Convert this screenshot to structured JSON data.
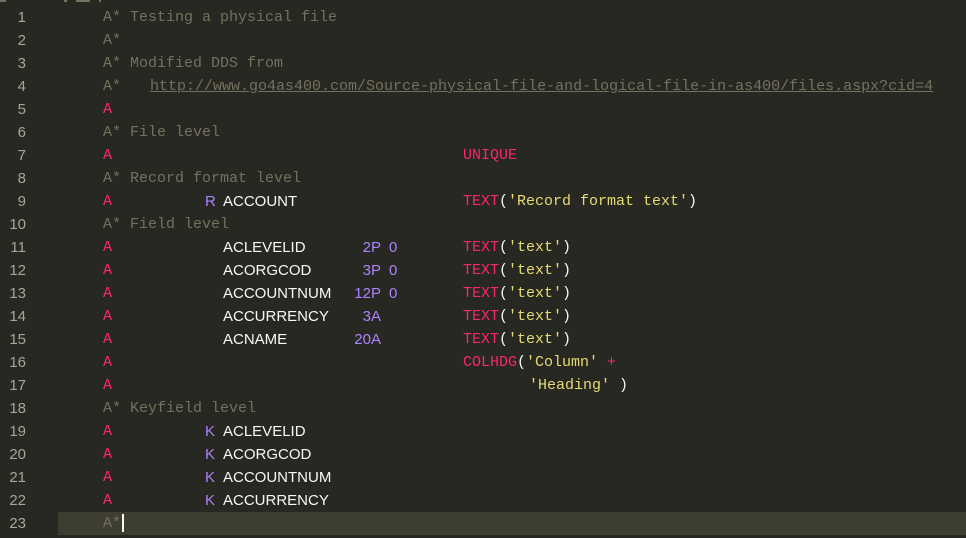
{
  "editor": {
    "colors": {
      "background": "#272822",
      "current_line": "#3e3d32",
      "comment": "#75715e",
      "keyword_red": "#f92672",
      "string_yellow": "#e6db74",
      "purple": "#ae81ff",
      "plain": "#f8f8f2",
      "line_number": "#a6a69c"
    },
    "lines": [
      {
        "num": "1",
        "spec": "A*",
        "text": " Testing a physical file"
      },
      {
        "num": "2",
        "spec": "A*",
        "text": ""
      },
      {
        "num": "3",
        "spec": "A*",
        "text": " Modified DDS from"
      },
      {
        "num": "4",
        "spec": "A*",
        "text": "",
        "url": "http://www.go4as400.com/Source-physical-file-and-logical-file-in-as400/files.aspx?cid=4"
      },
      {
        "num": "5",
        "spec": "A"
      },
      {
        "num": "6",
        "spec": "A*",
        "text": " File level"
      },
      {
        "num": "7",
        "spec": "A",
        "keyword": "UNIQUE"
      },
      {
        "num": "8",
        "spec": "A*",
        "text": " Record format level"
      },
      {
        "num": "9",
        "spec": "A",
        "type": "R",
        "name": "ACCOUNT",
        "keyword": "TEXT",
        "paren_open": "(",
        "string": "'Record format text'",
        "paren_close": ")"
      },
      {
        "num": "10",
        "spec": "A*",
        "text": " Field level"
      },
      {
        "num": "11",
        "spec": "A",
        "name": "ACLEVELID",
        "len": "2P",
        "dec": "0",
        "keyword": "TEXT",
        "paren_open": "(",
        "string": "'text'",
        "paren_close": ")"
      },
      {
        "num": "12",
        "spec": "A",
        "name": "ACORGCOD",
        "len": "3P",
        "dec": "0",
        "keyword": "TEXT",
        "paren_open": "(",
        "string": "'text'",
        "paren_close": ")"
      },
      {
        "num": "13",
        "spec": "A",
        "name": "ACCOUNTNUM",
        "len": "12P",
        "dec": "0",
        "keyword": "TEXT",
        "paren_open": "(",
        "string": "'text'",
        "paren_close": ")"
      },
      {
        "num": "14",
        "spec": "A",
        "name": "ACCURRENCY",
        "len": "3A",
        "keyword": "TEXT",
        "paren_open": "(",
        "string": "'text'",
        "paren_close": ")"
      },
      {
        "num": "15",
        "spec": "A",
        "name": "ACNAME",
        "len": "20A",
        "keyword": "TEXT",
        "paren_open": "(",
        "string": "'text'",
        "paren_close": ")"
      },
      {
        "num": "16",
        "spec": "A",
        "keyword": "COLHDG",
        "paren_open": "(",
        "string": "'Column'",
        "plus": "+"
      },
      {
        "num": "17",
        "spec": "A",
        "string2": "'Heading'",
        "paren_close2": ")"
      },
      {
        "num": "18",
        "spec": "A*",
        "text": " Keyfield level"
      },
      {
        "num": "19",
        "spec": "A",
        "type": "K",
        "name": "ACLEVELID"
      },
      {
        "num": "20",
        "spec": "A",
        "type": "K",
        "name": "ACORGCOD"
      },
      {
        "num": "21",
        "spec": "A",
        "type": "K",
        "name": "ACCOUNTNUM"
      },
      {
        "num": "22",
        "spec": "A",
        "type": "K",
        "name": "ACCURRENCY"
      },
      {
        "num": "23",
        "spec": "A*",
        "current": true
      }
    ]
  }
}
